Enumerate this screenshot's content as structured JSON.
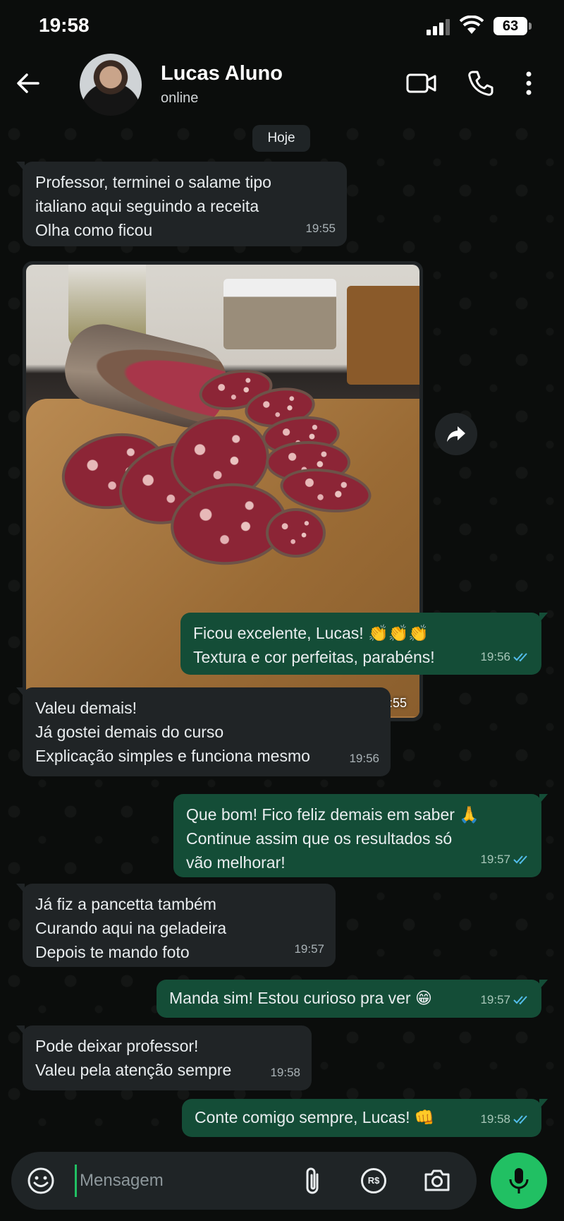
{
  "status_bar": {
    "time": "19:58",
    "battery": "63"
  },
  "header": {
    "contact_name": "Lucas Aluno",
    "contact_status": "online"
  },
  "chat": {
    "date_chip": "Hoje",
    "messages": [
      {
        "dir": "in",
        "lines": [
          "Professor, terminei o salame tipo",
          "italiano aqui seguindo a receita",
          "Olha como ficou"
        ],
        "time": "19:55"
      },
      {
        "dir": "in",
        "type": "image",
        "time": "19:55"
      },
      {
        "dir": "out",
        "lines": [
          "Ficou excelente, Lucas! 👏👏👏",
          "Textura e cor perfeitas, parabéns!"
        ],
        "time": "19:56"
      },
      {
        "dir": "in",
        "lines": [
          "Valeu demais!",
          "Já gostei demais do curso",
          "Explicação simples e funciona mesmo"
        ],
        "time": "19:56"
      },
      {
        "dir": "out",
        "lines": [
          "Que bom! Fico feliz demais em saber 🙏",
          "Continue assim que os resultados só",
          "vão melhorar!"
        ],
        "time": "19:57"
      },
      {
        "dir": "in",
        "lines": [
          "Já fiz a pancetta também",
          "Curando aqui na geladeira",
          "Depois te mando foto"
        ],
        "time": "19:57"
      },
      {
        "dir": "out",
        "lines": [
          "Manda sim! Estou curioso pra ver 😁"
        ],
        "time": "19:57"
      },
      {
        "dir": "in",
        "lines": [
          "Pode deixar professor!",
          "Valeu pela atenção sempre"
        ],
        "time": "19:58"
      },
      {
        "dir": "out",
        "lines": [
          "Conte comigo sempre, Lucas! 👊"
        ],
        "time": "19:58"
      }
    ]
  },
  "composer": {
    "placeholder": "Mensagem",
    "pay_label": "R$"
  },
  "colors": {
    "incoming": "#202426",
    "outgoing": "#144d37",
    "accent": "#21c063",
    "read_ticks": "#53bdeb"
  },
  "icons": [
    "back-arrow-icon",
    "video-call-icon",
    "phone-icon",
    "more-menu-icon",
    "forward-icon",
    "emoji-icon",
    "attach-icon",
    "payment-icon",
    "camera-icon",
    "mic-icon",
    "read-receipt-icon"
  ]
}
